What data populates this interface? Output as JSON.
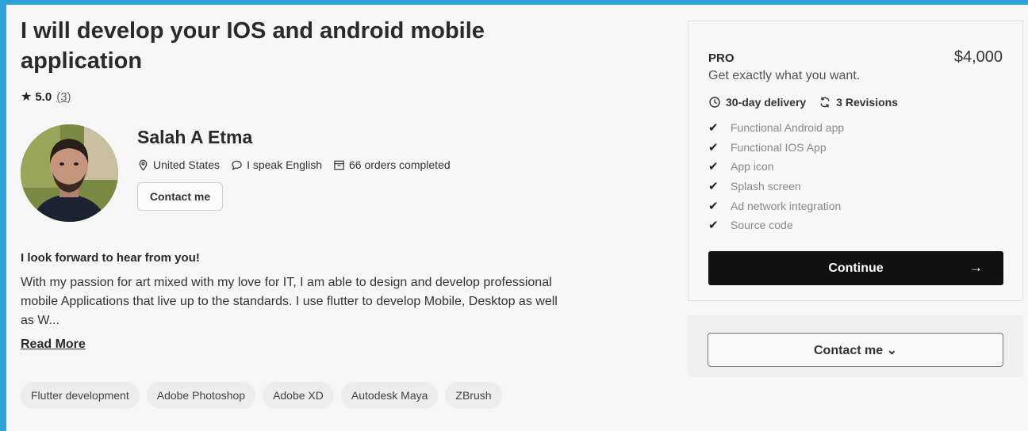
{
  "gig": {
    "title": "I will develop your IOS and android mobile application",
    "rating": {
      "score": "5.0",
      "count": "(3)"
    }
  },
  "seller": {
    "name": "Salah A Etma",
    "location": "United States",
    "language": "I speak English",
    "orders": "66 orders completed",
    "contact_label": "Contact me"
  },
  "about": {
    "heading": "I look forward to hear from you!",
    "body": "With my passion for art mixed with my love for IT, I am able to design and develop professional mobile Applications that live up to the standards. I use flutter to develop Mobile, Desktop as well as W...",
    "read_more": "Read More"
  },
  "tags": [
    "Flutter development",
    "Adobe Photoshop",
    "Adobe XD",
    "Autodesk Maya",
    "ZBrush"
  ],
  "package": {
    "tier": "PRO",
    "price": "$4,000",
    "tagline": "Get exactly what you want.",
    "delivery": "30-day delivery",
    "revisions": "3 Revisions",
    "features": [
      "Functional Android app",
      "Functional IOS App",
      "App icon",
      "Splash screen",
      "Ad network integration",
      "Source code"
    ],
    "continue_label": "Continue",
    "arrow": "→"
  },
  "contact_panel": {
    "label": "Contact me ⌄"
  },
  "colors": {
    "accent_border": "#2ea1d8",
    "continue_bg": "#111111"
  }
}
